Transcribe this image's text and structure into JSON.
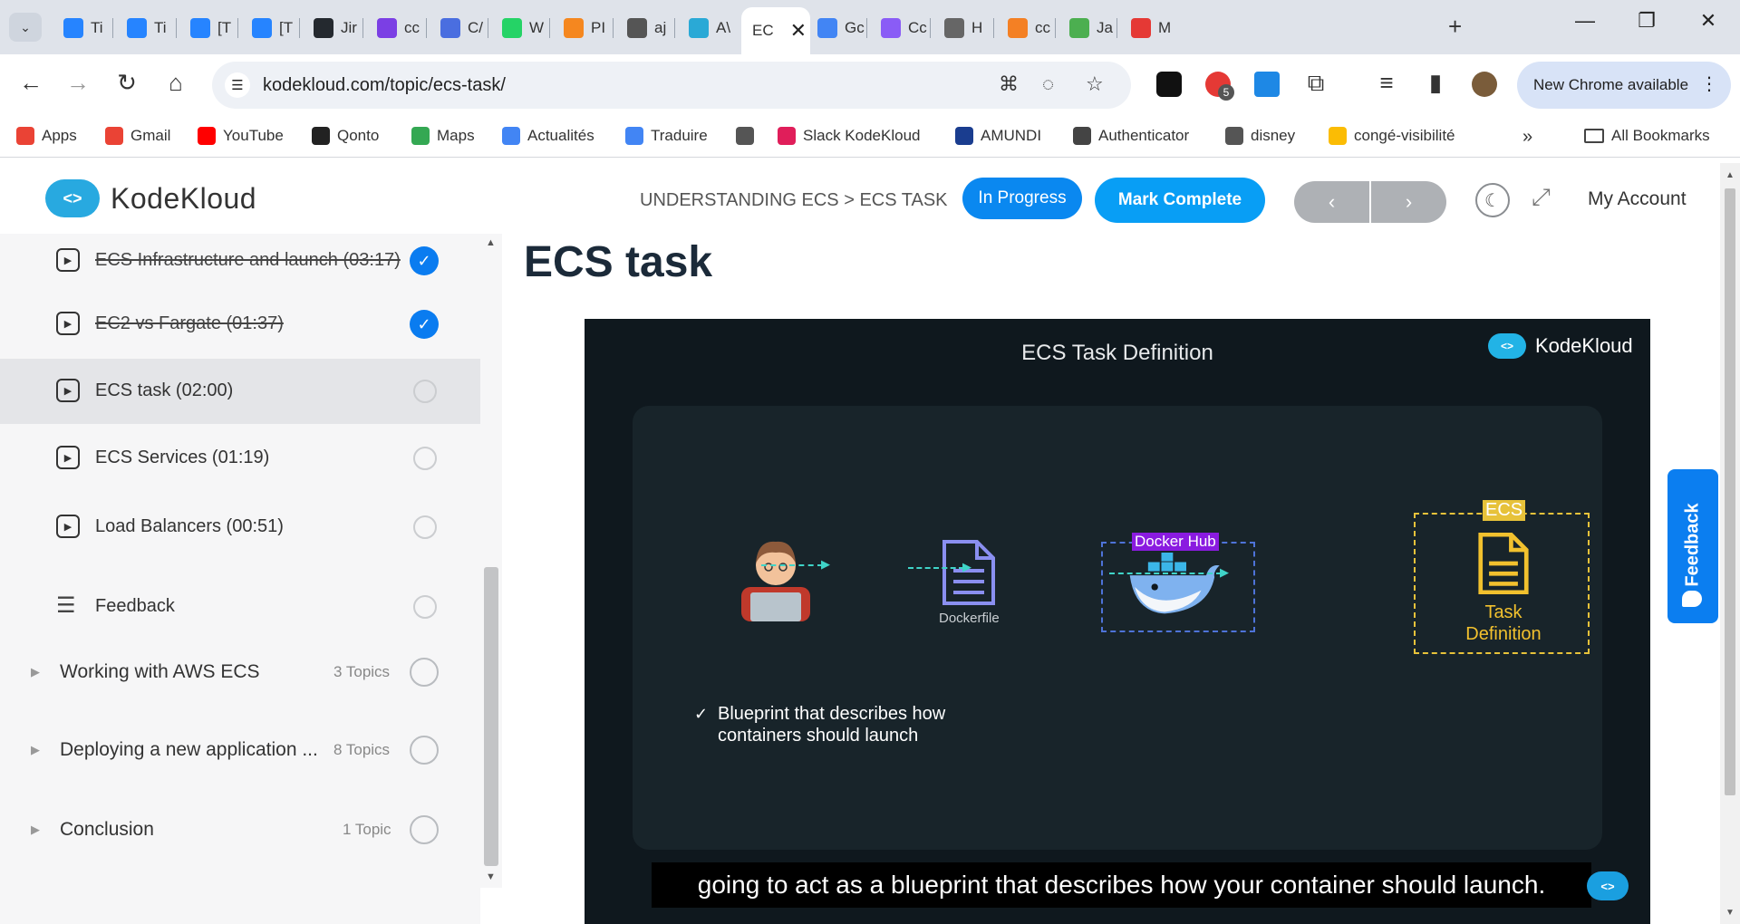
{
  "browser": {
    "tabs": [
      {
        "label": "Ti",
        "color": "#2684ff"
      },
      {
        "label": "Ti",
        "color": "#2684ff"
      },
      {
        "label": "[T",
        "color": "#2684ff"
      },
      {
        "label": "[T",
        "color": "#2684ff"
      },
      {
        "label": "Jir",
        "color": "#24292f"
      },
      {
        "label": "cc",
        "color": "#7b3fe4"
      },
      {
        "label": "C/",
        "color": "#4a6ee0"
      },
      {
        "label": "W",
        "color": "#25d366"
      },
      {
        "label": "PI",
        "color": "#f5871f"
      },
      {
        "label": "aj",
        "color": "#555555"
      },
      {
        "label": "A\\",
        "color": "#2aa9d6"
      },
      {
        "label": "EC",
        "color": "#ffffff",
        "active": true
      },
      {
        "label": "Gc",
        "color": "#4285f4"
      },
      {
        "label": "Cc",
        "color": "#8a5cf6"
      },
      {
        "label": "H",
        "color": "#666666"
      },
      {
        "label": "cc",
        "color": "#f48024"
      },
      {
        "label": "Ja",
        "color": "#4caf50"
      },
      {
        "label": "M",
        "color": "#e53935"
      }
    ],
    "url": "kodekloud.com/topic/ecs-task/",
    "chrome_update_label": "New Chrome available",
    "extension_badge": "5",
    "bookmarks": [
      {
        "label": "Apps",
        "color": "#ea4335"
      },
      {
        "label": "Gmail",
        "color": "#ea4335"
      },
      {
        "label": "YouTube",
        "color": "#ff0000"
      },
      {
        "label": "Qonto",
        "color": "#222222"
      },
      {
        "label": "Maps",
        "color": "#34a853"
      },
      {
        "label": "Actualités",
        "color": "#4285f4"
      },
      {
        "label": "Traduire",
        "color": "#4285f4"
      },
      {
        "label": "",
        "color": "#555555"
      },
      {
        "label": "Slack KodeKloud",
        "color": "#e01e5a"
      },
      {
        "label": "AMUNDI",
        "color": "#1a3d8f"
      },
      {
        "label": "Authenticator",
        "color": "#444444"
      },
      {
        "label": "disney",
        "color": "#555555"
      },
      {
        "label": "congé-visibilité",
        "color": "#fbbc04"
      }
    ],
    "bookmarks_overflow": "»",
    "all_bookmarks_label": "All Bookmarks"
  },
  "header": {
    "logo_text": "KodeKloud",
    "breadcrumb": "UNDERSTANDING ECS > ECS TASK",
    "status_label": "In Progress",
    "mark_complete_label": "Mark Complete",
    "prev_label": "‹",
    "next_label": "›",
    "account_label": "My Account"
  },
  "sidebar": {
    "lessons": [
      {
        "title": "ECS Infrastructure and launch (03:17)",
        "completed": true
      },
      {
        "title": "EC2 vs Fargate (01:37)",
        "completed": true
      },
      {
        "title": "ECS task (02:00)",
        "completed": false,
        "current": true
      },
      {
        "title": "ECS Services (01:19)",
        "completed": false
      },
      {
        "title": "Load Balancers (00:51)",
        "completed": false
      }
    ],
    "feedback_label": "Feedback",
    "sections": [
      {
        "title": "Working with AWS ECS",
        "count": "3 Topics"
      },
      {
        "title": "Deploying a new application ...",
        "count": "8 Topics"
      },
      {
        "title": "Conclusion",
        "count": "1 Topic"
      }
    ]
  },
  "main": {
    "title": "ECS task",
    "video": {
      "slide_title": "ECS Task Definition",
      "logo_text": "KodeKloud",
      "dockerfile_label": "Dockerfile",
      "docker_hub_label": "Docker Hub",
      "ecs_label": "ECS",
      "task_definition_label_1": "Task",
      "task_definition_label_2": "Definition",
      "bullet_line_1": "Blueprint that describes how",
      "bullet_line_2": "containers should launch",
      "bullet_tick": "✓",
      "subtitle": "going to act as a blueprint that describes how your container should launch."
    }
  },
  "feedback_tab_label": "Feedback"
}
